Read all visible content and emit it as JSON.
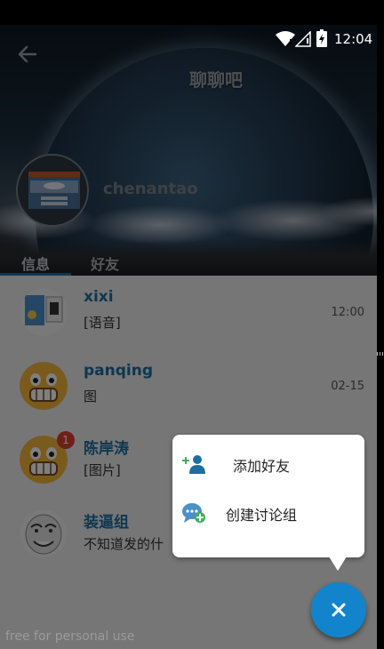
{
  "status_bar": {
    "time": "12:04"
  },
  "header": {
    "title": "聊聊吧",
    "username": "chenantao"
  },
  "tabs": [
    {
      "label": "信息",
      "active": true
    },
    {
      "label": "好友",
      "active": false
    }
  ],
  "conversations": [
    {
      "name": "xixi",
      "message": "[语音]",
      "time": "12:00",
      "badge": ""
    },
    {
      "name": "panqing",
      "message": "图",
      "time": "02-15",
      "badge": ""
    },
    {
      "name": "陈岸涛",
      "message": "[图片]",
      "time": "",
      "badge": "1"
    },
    {
      "name": "装逼组",
      "message": "不知道发的什",
      "time": "",
      "badge": ""
    }
  ],
  "popup_menu": {
    "items": [
      {
        "label": "添加好友",
        "icon": "add-friend-icon"
      },
      {
        "label": "创建讨论组",
        "icon": "create-group-icon"
      }
    ]
  },
  "fab": {
    "icon": "close-icon"
  },
  "watermark": "free for personal use",
  "colors": {
    "accent": "#1284cc",
    "name_blue": "#1c6ea0",
    "badge_red": "#d9412f"
  }
}
